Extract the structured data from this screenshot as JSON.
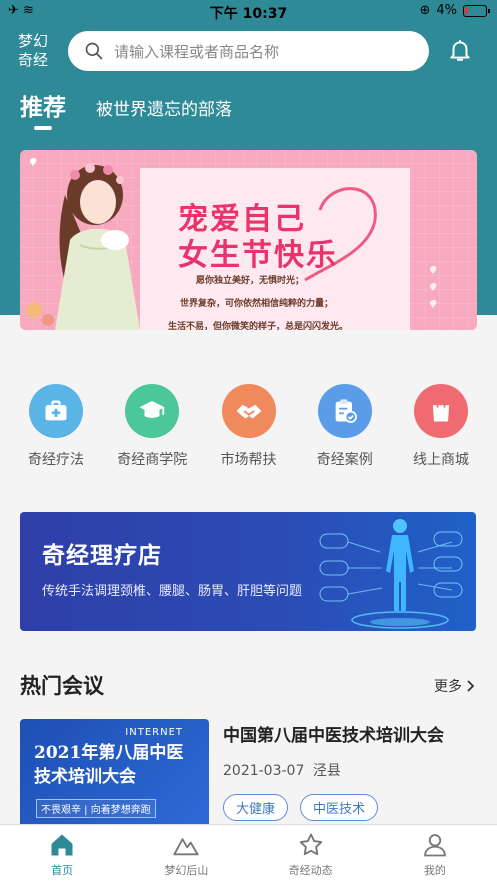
{
  "status_bar": {
    "time": "下午 10:37",
    "battery": "4%"
  },
  "header": {
    "brand": "梦幻奇经",
    "search_placeholder": "请输入课程或者商品名称"
  },
  "tabs": [
    {
      "label": "推荐"
    },
    {
      "label": "被世界遗忘的部落"
    }
  ],
  "banner": {
    "title_line1": "宠爱自己",
    "title_line2": "女生节快乐",
    "line1": "愿你独立美好，无惧时光；",
    "line2": "世界复杂，可你依然相信纯粹的力量；",
    "line3": "生活不易，但你微笑的样子，总是闪闪发光。"
  },
  "grid": [
    {
      "label": "奇经疗法",
      "icon": "first-aid-icon",
      "color": "#5ab4e6"
    },
    {
      "label": "奇经商学院",
      "icon": "graduation-cap-icon",
      "color": "#4cc79a"
    },
    {
      "label": "市场帮扶",
      "icon": "handshake-icon",
      "color": "#f08a5d"
    },
    {
      "label": "奇经案例",
      "icon": "clipboard-check-icon",
      "color": "#5a9ce8"
    },
    {
      "label": "线上商城",
      "icon": "shopping-bag-icon",
      "color": "#f06a72"
    }
  ],
  "promo": {
    "title": "奇经理疗店",
    "subtitle": "传统手法调理颈椎、腰腿、肠胃、肝胆等问题"
  },
  "hot_meetings": {
    "title": "热门会议",
    "more": "更多",
    "items": [
      {
        "image_label_top": "INTERNET",
        "image_title": "2021年第八届中医技术培训大会",
        "image_slogan": "不畏艰辛 | 向着梦想奔跑",
        "title": "中国第八届中医技术培训大会",
        "date": "2021-03-07",
        "location": "泾县",
        "tags": [
          "大健康",
          "中医技术"
        ]
      }
    ]
  },
  "tabbar": [
    {
      "label": "首页",
      "icon": "home-icon"
    },
    {
      "label": "梦幻后山",
      "icon": "mountain-icon"
    },
    {
      "label": "奇经动态",
      "icon": "star-icon"
    },
    {
      "label": "我的",
      "icon": "user-icon"
    }
  ],
  "colors": {
    "primary": "#2f8a98",
    "tag": "#3f78c8"
  }
}
